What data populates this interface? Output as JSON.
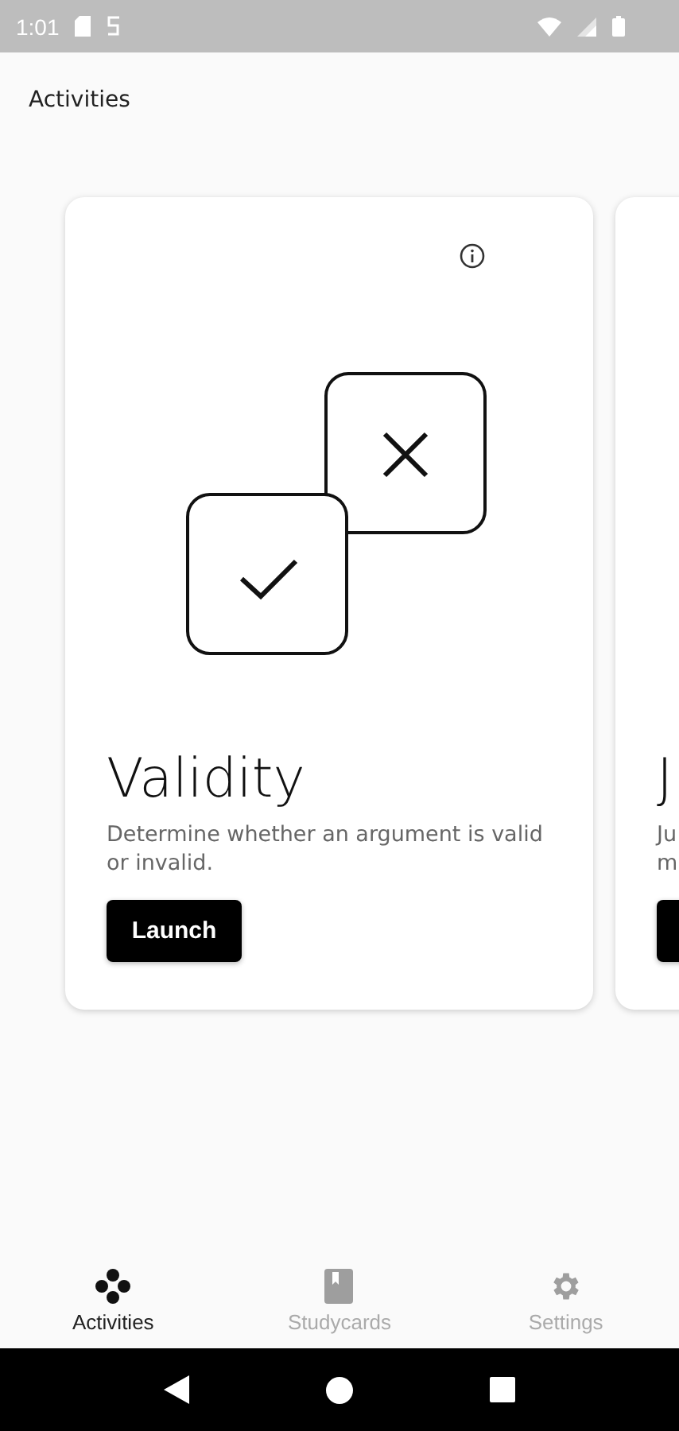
{
  "status_bar": {
    "time": "1:01"
  },
  "header": {
    "title": "Activities"
  },
  "cards": [
    {
      "kind": "full",
      "title": "Validity",
      "description_lines": [
        "Determine whether an argument is valid",
        "or invalid."
      ],
      "button": "Launch"
    },
    {
      "kind": "clipped",
      "title": "J",
      "description_lines": [
        "Ju",
        "m"
      ]
    }
  ],
  "bottom_nav": [
    {
      "label": "Activities",
      "kind": "activities",
      "selected": true
    },
    {
      "label": "Studycards",
      "kind": "studycards",
      "selected": false
    },
    {
      "label": "Settings",
      "kind": "settings",
      "selected": false
    }
  ]
}
